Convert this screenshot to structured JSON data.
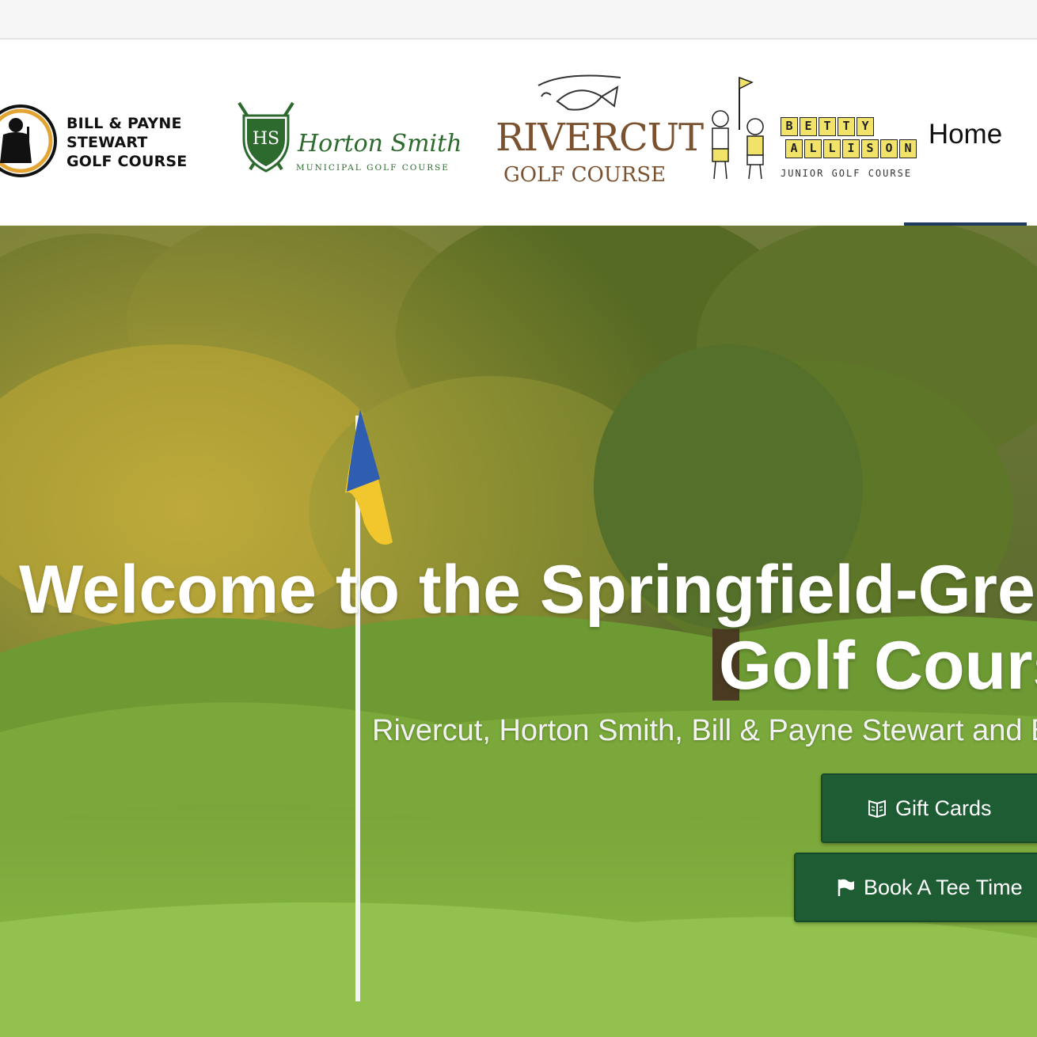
{
  "header": {
    "logos": {
      "bps": {
        "line1": "BILL & PAYNE",
        "line2": "STEWART",
        "line3": "GOLF COURSE"
      },
      "hs": {
        "name": "Horton Smith",
        "subtitle": "MUNICIPAL GOLF COURSE",
        "crest": "HS"
      },
      "rivercut": {
        "name": "RIVERCUT",
        "subtitle": "GOLF COURSE"
      },
      "betty": {
        "word1": [
          "B",
          "E",
          "T",
          "T",
          "Y"
        ],
        "word2": [
          "A",
          "L",
          "L",
          "I",
          "S",
          "O",
          "N"
        ],
        "subtitle": "JUNIOR GOLF COURSE"
      }
    },
    "nav": {
      "home_label": "Home",
      "active_color": "#1f3a5f"
    }
  },
  "hero": {
    "title_line1": "Welcome to the Springfield-Greene County",
    "title_line2": "Golf Courses",
    "subtitle": "Rivercut, Horton Smith, Bill & Payne Stewart and Betty Allison",
    "buttons": {
      "gift_label": "Gift Cards",
      "gift_icon": "gift-card-icon",
      "tee_label": "Book A Tee Time",
      "tee_icon": "flag-icon"
    },
    "button_color": "#1e5c34"
  }
}
